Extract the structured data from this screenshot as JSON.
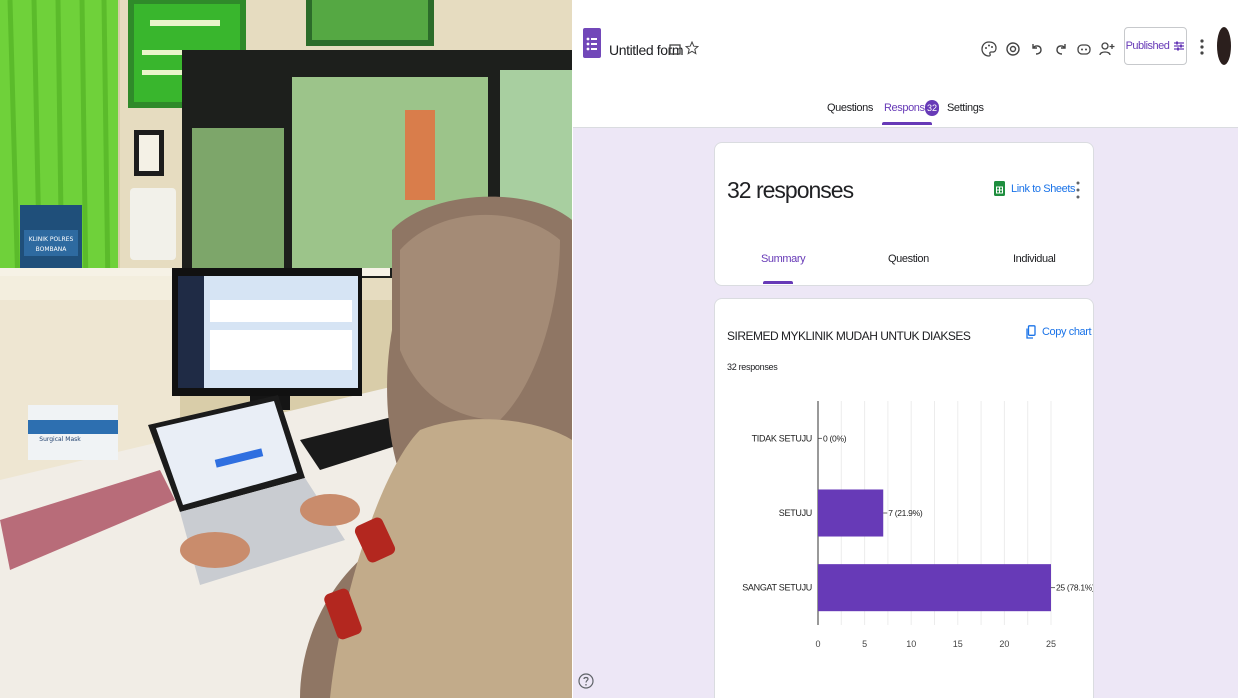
{
  "form": {
    "title": "Untitled form",
    "publish_label": "Published"
  },
  "tabs": [
    {
      "label": "Questions"
    },
    {
      "label": "Responses"
    },
    {
      "label": "Settings"
    }
  ],
  "responses_badge": "32",
  "summary": {
    "count_label": "32 responses",
    "sheets_link": "Link to Sheets",
    "subtabs": [
      {
        "label": "Summary"
      },
      {
        "label": "Question"
      },
      {
        "label": "Individual"
      }
    ]
  },
  "question": {
    "title": "SIREMED MYKLINIK MUDAH UNTUK DIAKSES",
    "responses_label": "32 responses",
    "copy_chart": "Copy chart"
  },
  "chart_data": {
    "type": "bar",
    "orientation": "horizontal",
    "categories": [
      "TIDAK SETUJU",
      "SETUJU",
      "SANGAT SETUJU"
    ],
    "values": [
      0,
      7,
      25
    ],
    "data_labels": [
      "0 (0%)",
      "7 (21.9%)",
      "25 (78.1%)"
    ],
    "xlim": [
      0,
      25
    ],
    "xticks": [
      0,
      5,
      10,
      15,
      20,
      25
    ],
    "grid": true,
    "color": "#673ab7"
  },
  "photo": {
    "banner_lines": [
      "KLINIK POLRES",
      "BOMBANA"
    ],
    "mask_box_label": "Surgical Mask"
  },
  "colors": {
    "accent": "#673ab7",
    "link": "#1a73e8",
    "background": "#ede7f6"
  },
  "icons": [
    "forms-logo-icon",
    "folder-icon",
    "star-icon",
    "palette-icon",
    "preview-icon",
    "undo-icon",
    "redo-icon",
    "addon-icon",
    "add-collaborator-icon",
    "customize-icon",
    "more-vert-icon",
    "sheets-icon",
    "copy-icon",
    "help-icon"
  ]
}
